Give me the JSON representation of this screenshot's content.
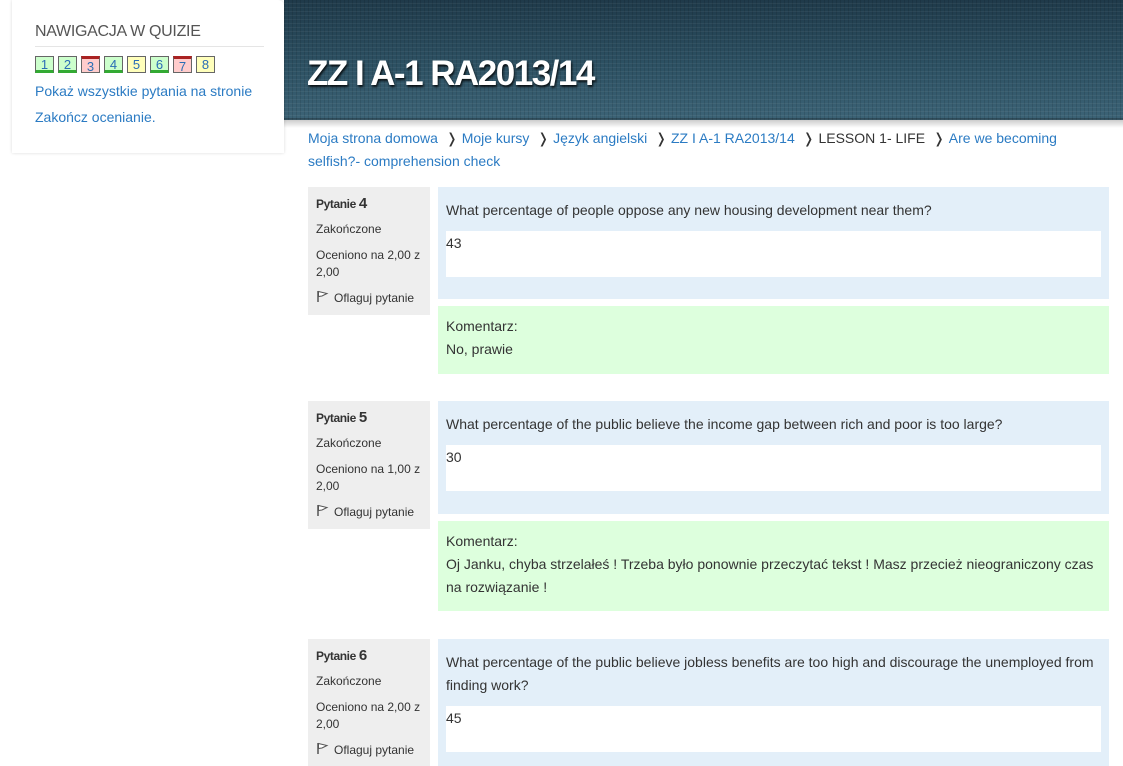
{
  "header": {
    "site_title": "ZZ I A-1 RA2013/14"
  },
  "quiz_nav": {
    "heading": "NAWIGACJA W QUIZIE",
    "buttons": [
      {
        "label": "1",
        "state": "correct"
      },
      {
        "label": "2",
        "state": "correct"
      },
      {
        "label": "3",
        "state": "wrong"
      },
      {
        "label": "4",
        "state": "correct"
      },
      {
        "label": "5",
        "state": "partial"
      },
      {
        "label": "6",
        "state": "correct"
      },
      {
        "label": "7",
        "state": "wrong"
      },
      {
        "label": "8",
        "state": "partial"
      }
    ],
    "show_all_link": "Pokaż wszystkie pytania na stronie",
    "finish_link": "Zakończ ocenianie."
  },
  "breadcrumb": {
    "items": [
      "Moja strona domowa",
      "Moje kursy",
      "Język angielski",
      "ZZ I A-1 RA2013/14"
    ],
    "current": "LESSON 1- LIFE",
    "last": "Are we becoming selfish?- comprehension check"
  },
  "questions": [
    {
      "label": "Pytanie",
      "number": "4",
      "status": "Zakończone",
      "grade": "Oceniono na 2,00 z 2,00",
      "flag": "Oflaguj pytanie",
      "text": "What percentage of people oppose any new housing development near them?",
      "answer": "43",
      "feedback_label": "Komentarz:",
      "feedback": "No, prawie"
    },
    {
      "label": "Pytanie",
      "number": "5",
      "status": "Zakończone",
      "grade": "Oceniono na 1,00 z 2,00",
      "flag": "Oflaguj pytanie",
      "text": "What percentage of the public believe the income gap between rich and poor is too large?",
      "answer": "30",
      "feedback_label": "Komentarz:",
      "feedback": "Oj Janku, chyba strzelałeś ! Trzeba było ponownie przeczytać tekst ! Masz przecież nieograniczony czas na rozwiązanie !"
    },
    {
      "label": "Pytanie",
      "number": "6",
      "status": "Zakończone",
      "grade": "Oceniono na 2,00 z 2,00",
      "flag": "Oflaguj pytanie",
      "text": "What percentage of the public believe jobless benefits are too high and discourage the unemployed from finding work?",
      "answer": "45"
    }
  ],
  "colors": {
    "correct": "#ccffcc",
    "wrong": "#ffcccc",
    "partial": "#ffffbb",
    "question_bg": "#e3eff9",
    "feedback_bg": "#ddffdd",
    "link": "#2b7bc3"
  }
}
